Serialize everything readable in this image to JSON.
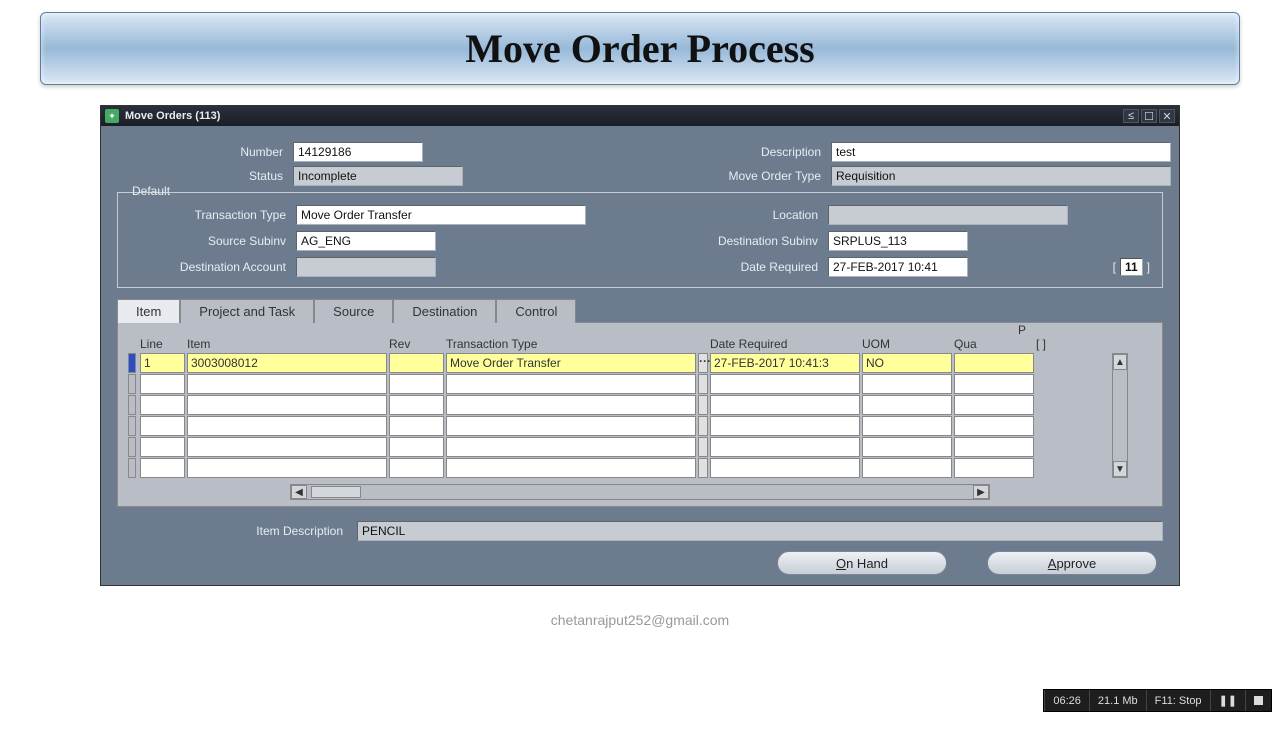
{
  "slide_title": "Move Order Process",
  "window": {
    "title": "Move Orders (113)"
  },
  "header": {
    "number_label": "Number",
    "number_value": "14129186",
    "status_label": "Status",
    "status_value": "Incomplete",
    "desc_label": "Description",
    "desc_value": "test",
    "type_label": "Move Order Type",
    "type_value": "Requisition"
  },
  "default": {
    "legend": "Default",
    "txn_label": "Transaction Type",
    "txn_value": "Move Order Transfer",
    "loc_label": "Location",
    "loc_value": "",
    "src_label": "Source Subinv",
    "src_value": "AG_ENG",
    "dst_label": "Destination Subinv",
    "dst_value": "SRPLUS_113",
    "acct_label": "Destination Account",
    "acct_value": "",
    "date_label": "Date Required",
    "date_value": "27-FEB-2017 10:41",
    "page": "11"
  },
  "tabs": {
    "t0": "Item",
    "t1": "Project and Task",
    "t2": "Source",
    "t3": "Destination",
    "t4": "Control"
  },
  "columns": {
    "line": "Line",
    "item": "Item",
    "rev": "Rev",
    "txn": "Transaction Type",
    "date": "Date Required",
    "uom": "UOM",
    "p": "P",
    "qua": "Qua",
    "flag": "[ ]"
  },
  "row0": {
    "line": "1",
    "item": "3003008012",
    "rev": "",
    "txn": "Move Order Transfer",
    "date": "27-FEB-2017 10:41:3",
    "uom": "NO",
    "qty": ""
  },
  "item_desc": {
    "label": "Item Description",
    "value": "PENCIL"
  },
  "buttons": {
    "on_hand_u": "O",
    "on_hand_r": "n Hand",
    "approve_u": "A",
    "approve_r": "pprove"
  },
  "footer": "chetanrajput252@gmail.com",
  "recorder": {
    "time": "06:26",
    "size": "21.1 Mb",
    "hotkey": "F11: Stop"
  }
}
